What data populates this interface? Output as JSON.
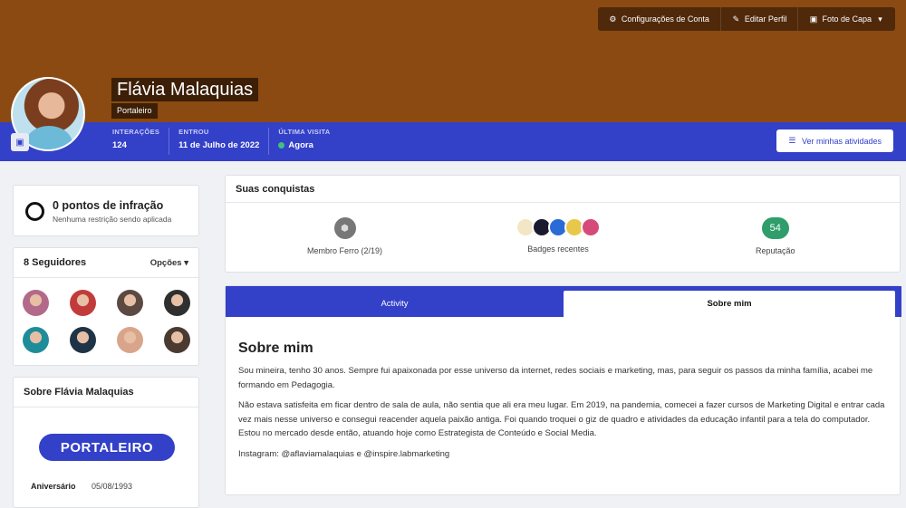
{
  "cover": {
    "color": "#8a4a12",
    "actions": [
      {
        "icon": "gear-icon",
        "label": "Configurações de Conta"
      },
      {
        "icon": "pencil-icon",
        "label": "Editar Perfil"
      },
      {
        "icon": "image-icon",
        "label": "Foto de Capa"
      }
    ]
  },
  "profile": {
    "name": "Flávia Malaquias",
    "role": "Portaleiro",
    "stats": [
      {
        "label": "INTERAÇÕES",
        "value": "124"
      },
      {
        "label": "ENTROU",
        "value": "11 de Julho de 2022"
      },
      {
        "label": "ÚLTIMA VISITA",
        "value": "Agora"
      }
    ],
    "activity_button": "Ver minhas atividades",
    "accent": "#3340c8"
  },
  "infractions": {
    "title": "0 pontos de infração",
    "subtitle": "Nenhuma restrição sendo aplicada"
  },
  "followers": {
    "title": "8 Seguidores",
    "options": "Opções",
    "avatars": [
      "#b36a8a",
      "#c23b3b",
      "#5c4a42",
      "#2f2f2f",
      "#1f8c9a",
      "#1e3346",
      "#d9a58a",
      "#4a3a30"
    ]
  },
  "about_sidebar": {
    "title": "Sobre Flávia Malaquias",
    "badge": "PORTALEIRO",
    "birthday_label": "Aniversário",
    "birthday_value": "05/08/1993"
  },
  "achievements": {
    "title": "Suas conquistas",
    "rank_label": "Membro Ferro (2/19)",
    "badges_label": "Badges recentes",
    "badge_colors": [
      "#f3e6c4",
      "#1a1a2e",
      "#2a6bd6",
      "#e8c84a",
      "#d64a7a"
    ],
    "reputation": "54",
    "reputation_label": "Reputação"
  },
  "tabs": [
    {
      "label": "Activity"
    },
    {
      "label": "Sobre mim"
    }
  ],
  "about": {
    "title": "Sobre mim",
    "p1": "Sou mineira, tenho 30 anos. Sempre fui apaixonada por esse universo da internet, redes sociais e marketing, mas, para seguir os passos da minha família, acabei me formando em Pedagogia.",
    "p2": "Não estava satisfeita em ficar dentro de sala de aula, não sentia que ali era meu lugar. Em 2019, na pandemia, comecei a fazer cursos de Marketing Digital e entrar cada vez mais nesse universo e consegui reacender aquela paixão antiga. Foi quando troquei o giz de quadro e atividades da educação infantil para a tela do computador. Estou no mercado desde então, atuando hoje como Estrategista de Conteúdo e Social Media.",
    "p3": "Instagram: @aflaviamalaquias e @inspire.labmarketing"
  }
}
